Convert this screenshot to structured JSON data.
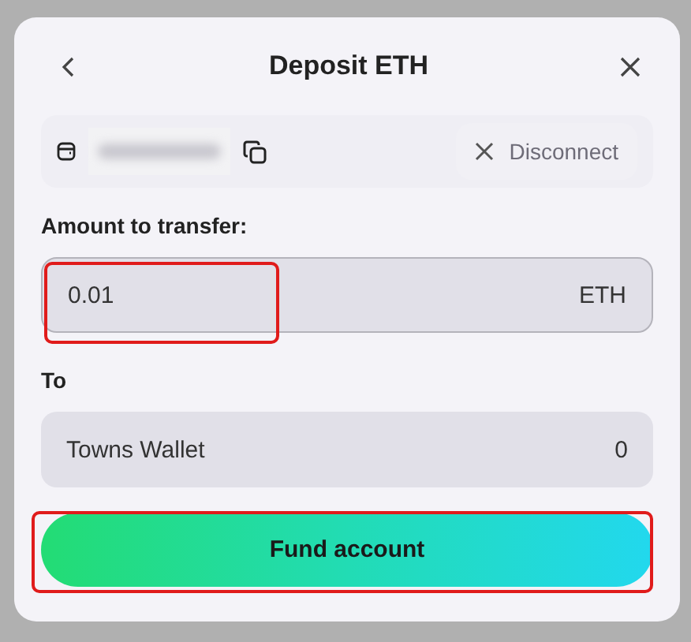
{
  "dialog": {
    "title": "Deposit ETH"
  },
  "wallet": {
    "disconnect_label": "Disconnect"
  },
  "amount": {
    "label": "Amount to transfer:",
    "value": "0.01",
    "unit": "ETH"
  },
  "destination": {
    "label": "To",
    "name": "Towns Wallet",
    "balance": "0"
  },
  "primary_button": {
    "label": "Fund account"
  }
}
